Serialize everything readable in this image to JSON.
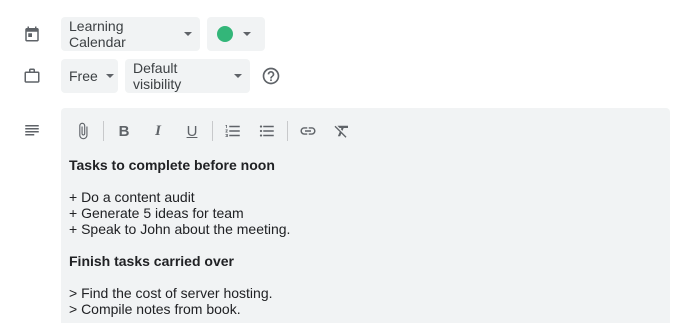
{
  "calendar_row": {
    "calendar_label": "Learning Calendar",
    "color_hex": "#33b679"
  },
  "availability_row": {
    "status_label": "Free",
    "visibility_label": "Default visibility"
  },
  "toolbar": {
    "bold_label": "B",
    "italic_label": "I",
    "underline_label": "U"
  },
  "description": {
    "heading1": "Tasks to complete before noon",
    "items1": [
      "+ Do a content audit",
      "+ Generate 5 ideas for team",
      "+ Speak to John about the meeting."
    ],
    "heading2": "Finish tasks carried over",
    "items2": [
      "> Find the cost of server hosting.",
      "> Compile notes from book."
    ]
  },
  "colors": {
    "field_bg": "#f1f3f4",
    "icon_gray": "#5f6368"
  }
}
